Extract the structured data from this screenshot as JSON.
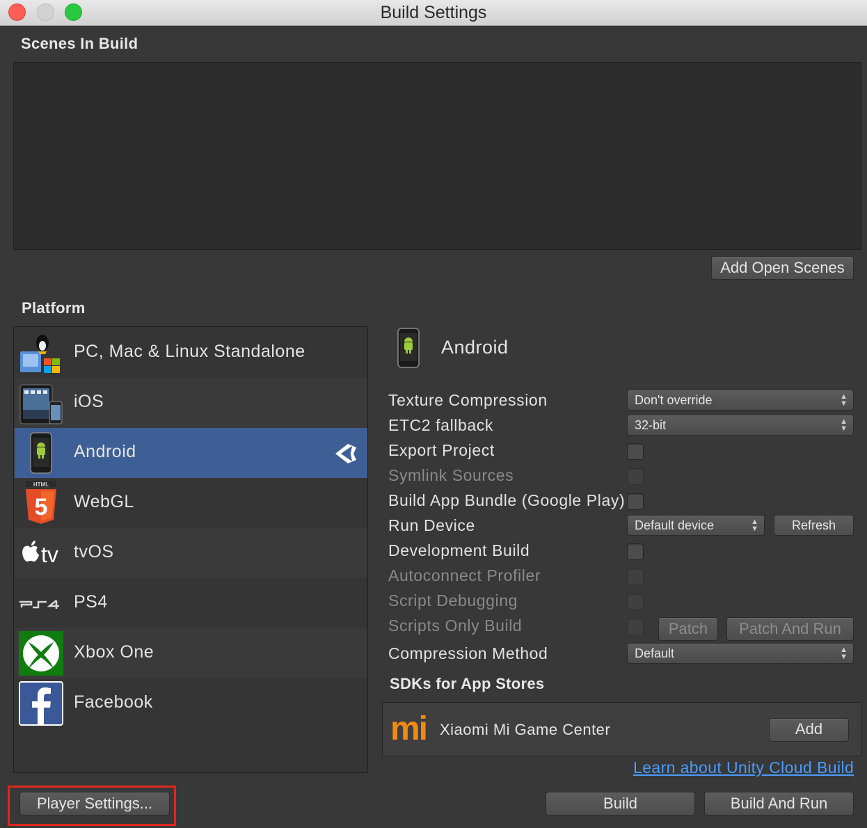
{
  "window": {
    "title": "Build Settings"
  },
  "scenes": {
    "label": "Scenes In Build",
    "add_open_scenes": "Add Open Scenes"
  },
  "platform": {
    "label": "Platform",
    "items": [
      {
        "name": "PC, Mac & Linux Standalone",
        "icon": "pc-mac-linux-icon"
      },
      {
        "name": "iOS",
        "icon": "ios-devices-icon"
      },
      {
        "name": "Android",
        "icon": "android-phone-icon",
        "selected": true
      },
      {
        "name": "WebGL",
        "icon": "html5-icon"
      },
      {
        "name": "tvOS",
        "icon": "apple-tv-icon"
      },
      {
        "name": "PS4",
        "icon": "ps4-logo-icon"
      },
      {
        "name": "Xbox One",
        "icon": "xbox-icon"
      },
      {
        "name": "Facebook",
        "icon": "facebook-icon"
      }
    ],
    "current_target_icon": "unity-logo-icon"
  },
  "android": {
    "title": "Android",
    "settings": {
      "texture_compression": {
        "label": "Texture Compression",
        "value": "Don't override"
      },
      "etc2_fallback": {
        "label": "ETC2 fallback",
        "value": "32-bit"
      },
      "export_project": {
        "label": "Export Project"
      },
      "symlink_sources": {
        "label": "Symlink Sources"
      },
      "build_app_bundle": {
        "label": "Build App Bundle (Google Play)"
      },
      "run_device": {
        "label": "Run Device",
        "value": "Default device",
        "refresh": "Refresh"
      },
      "development_build": {
        "label": "Development Build"
      },
      "autoconnect_profiler": {
        "label": "Autoconnect Profiler"
      },
      "script_debugging": {
        "label": "Script Debugging"
      },
      "scripts_only_build": {
        "label": "Scripts Only Build",
        "patch": "Patch",
        "patch_and_run": "Patch And Run"
      },
      "compression_method": {
        "label": "Compression Method",
        "value": "Default"
      }
    },
    "sdks": {
      "label": "SDKs for App Stores",
      "items": [
        {
          "name": "Xiaomi Mi Game Center",
          "add": "Add",
          "logo_text": "mi"
        }
      ]
    },
    "cloud_link": "Learn about Unity Cloud Build"
  },
  "footer": {
    "player_settings": "Player Settings...",
    "build": "Build",
    "build_and_run": "Build And Run"
  },
  "colors": {
    "background": "#383838",
    "selection": "#3e5f96",
    "link": "#4a9bff",
    "highlight_box": "#e0261c"
  }
}
